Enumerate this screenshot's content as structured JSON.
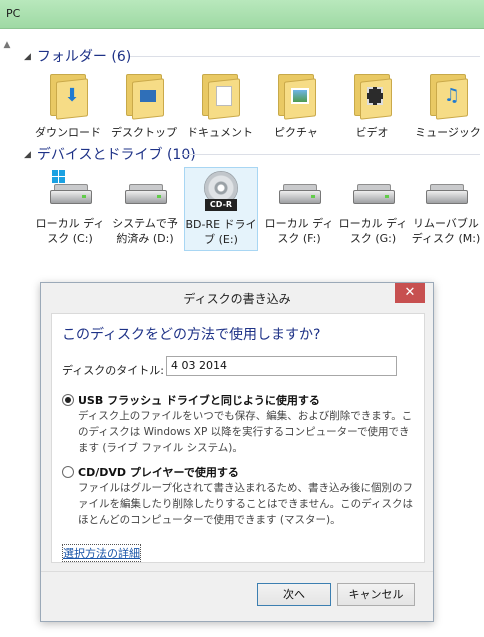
{
  "window": {
    "title": "PC"
  },
  "folders": {
    "header": "フォルダー (6)",
    "items": [
      {
        "label": "ダウンロード",
        "icon": "download-arrow-icon"
      },
      {
        "label": "デスクトップ",
        "icon": "desktop-icon"
      },
      {
        "label": "ドキュメント",
        "icon": "document-icon"
      },
      {
        "label": "ピクチャ",
        "icon": "picture-icon"
      },
      {
        "label": "ビデオ",
        "icon": "video-film-icon"
      },
      {
        "label": "ミュージック",
        "icon": "music-note-icon"
      }
    ]
  },
  "devices": {
    "header": "デバイスとドライブ (10)",
    "items": [
      {
        "label": "ローカル ディスク (C:)"
      },
      {
        "label": "システムで予約済み (D:)"
      },
      {
        "label": "BD-RE ドライブ (E:)",
        "tag": "CD-R"
      },
      {
        "label": "ローカル ディスク (F:)"
      },
      {
        "label": "ローカル ディスク (G:)"
      },
      {
        "label": "リムーバブル ディスク (M:)"
      }
    ]
  },
  "dialog": {
    "title": "ディスクの書き込み",
    "close": "✕",
    "question": "このディスクをどの方法で使用しますか?",
    "disc_title_label": "ディスクのタイトル:",
    "disc_title_value": "4 03 2014",
    "option_usb": {
      "title": "USB フラッシュ ドライブと同じように使用する",
      "desc": "ディスク上のファイルをいつでも保存、編集、および削除できます。このディスクは Windows XP 以降を実行するコンピューターで使用できます (ライブ ファイル システム)。",
      "selected": true
    },
    "option_cd": {
      "title": "CD/DVD プレイヤーで使用する",
      "desc": "ファイルはグループ化されて書き込まれるため、書き込み後に個別のファイルを編集したり削除したりすることはできません。このディスクはほとんどのコンピューターで使用できます (マスター)。",
      "selected": false
    },
    "details_link": "選択方法の詳細",
    "next_button": "次へ",
    "cancel_button": "キャンセル"
  }
}
